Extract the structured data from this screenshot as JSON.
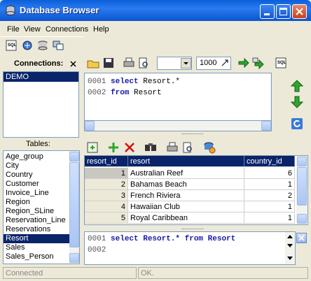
{
  "window": {
    "title": "Database Browser"
  },
  "menu": [
    "File",
    "View",
    "Connections",
    "Help"
  ],
  "connections": {
    "header": "Connections:",
    "items": [
      "DEMO"
    ],
    "selected": 0
  },
  "tables": {
    "header": "Tables:",
    "items": [
      "Age_group",
      "City",
      "Country",
      "Customer",
      "Invoice_Line",
      "Region",
      "Region_SLine",
      "Reservation_Line",
      "Reservations",
      "Resort",
      "Sales",
      "Sales_Person"
    ],
    "selected": 9
  },
  "toolbar": {
    "limit_value": "1000",
    "combo_value": ""
  },
  "editor": {
    "lines": [
      {
        "num": "0001",
        "keyword": "select",
        "rest": " Resort.*"
      },
      {
        "num": "0002",
        "keyword": "from",
        "rest": " Resort"
      }
    ]
  },
  "grid": {
    "columns": [
      "resort_id",
      "resort",
      "country_id"
    ],
    "rows": [
      {
        "id": "1",
        "resort": "Australian Reef",
        "country_id": "6"
      },
      {
        "id": "2",
        "resort": "Bahamas Beach",
        "country_id": "1"
      },
      {
        "id": "3",
        "resort": "French Riviera",
        "country_id": "2"
      },
      {
        "id": "4",
        "resort": "Hawaiian Club",
        "country_id": "1"
      },
      {
        "id": "5",
        "resort": "Royal Caribbean",
        "country_id": "1"
      }
    ]
  },
  "history": {
    "lines": [
      {
        "num": "0001",
        "text": "select Resort.* from Resort"
      },
      {
        "num": "0002",
        "text": ""
      }
    ]
  },
  "status": {
    "left": "Connected",
    "right": "OK."
  },
  "colors": {
    "titlebar": "#0a5fd8",
    "selection": "#0a246a",
    "accent_green": "#2ea62e",
    "delete_red": "#d01010"
  }
}
